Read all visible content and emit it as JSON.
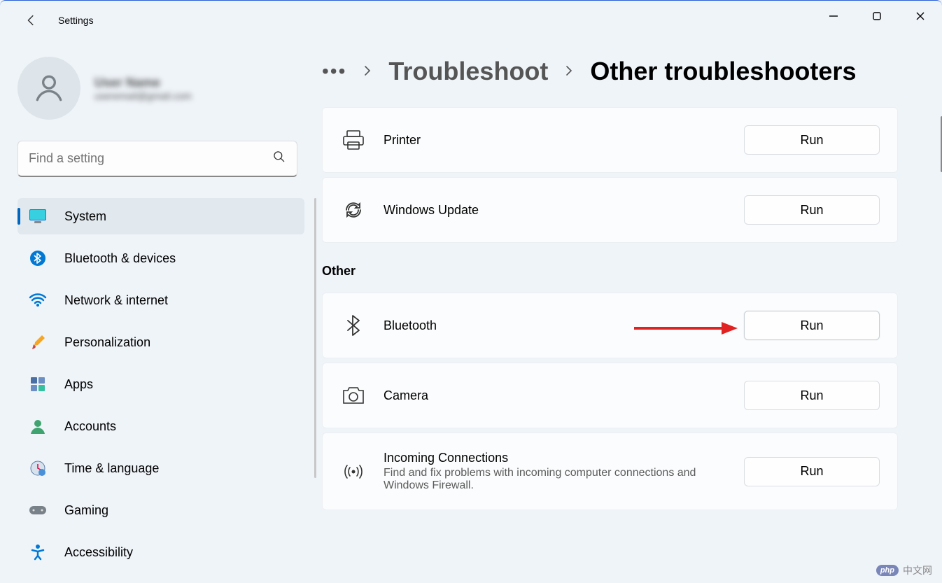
{
  "window": {
    "title": "Settings"
  },
  "profile": {
    "name_placeholder": "User Name",
    "email_placeholder": "useremail@gmail.com"
  },
  "search": {
    "placeholder": "Find a setting"
  },
  "sidebar": {
    "items": [
      {
        "label": "System",
        "icon": "monitor",
        "active": true
      },
      {
        "label": "Bluetooth & devices",
        "icon": "bluetooth"
      },
      {
        "label": "Network & internet",
        "icon": "wifi"
      },
      {
        "label": "Personalization",
        "icon": "paintbrush"
      },
      {
        "label": "Apps",
        "icon": "apps"
      },
      {
        "label": "Accounts",
        "icon": "account"
      },
      {
        "label": "Time & language",
        "icon": "clock"
      },
      {
        "label": "Gaming",
        "icon": "gaming"
      },
      {
        "label": "Accessibility",
        "icon": "accessibility"
      }
    ]
  },
  "breadcrumb": {
    "ellipsis": "•••",
    "link": "Troubleshoot",
    "current": "Other troubleshooters"
  },
  "troubleshooters_top": [
    {
      "label": "Printer",
      "icon": "printer",
      "action": "Run"
    },
    {
      "label": "Windows Update",
      "icon": "refresh",
      "action": "Run"
    }
  ],
  "section_other_label": "Other",
  "troubleshooters_other": [
    {
      "label": "Bluetooth",
      "icon": "bluetooth-outline",
      "action": "Run",
      "highlighted": true
    },
    {
      "label": "Camera",
      "icon": "camera",
      "action": "Run"
    },
    {
      "label": "Incoming Connections",
      "icon": "antenna",
      "sub": "Find and fix problems with incoming computer connections and Windows Firewall.",
      "action": "Run"
    }
  ],
  "watermark": "中文网"
}
